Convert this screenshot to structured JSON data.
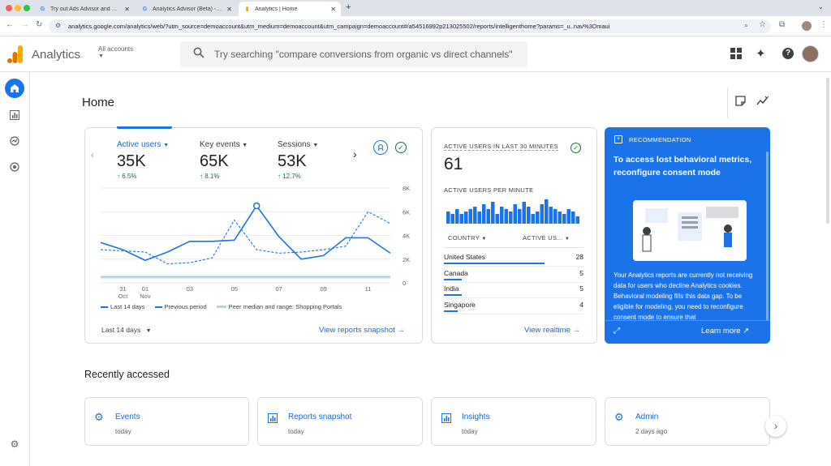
{
  "browser": {
    "tabs": [
      {
        "title": "Try out Ads Advisor and Analy"
      },
      {
        "title": "Analytics Advisor (Beta) - An"
      },
      {
        "title": "Analytics | Home"
      }
    ],
    "new_tab": "+",
    "url": "analytics.google.com/analytics/web/?utm_source=demoaccount&utm_medium=demoaccount&utm_campaign=demoaccount#/a54516992p213025502/reports/intelligenthome?params=_u..nav%3Dmaui"
  },
  "header": {
    "app_name": "Analytics",
    "account": "All accounts",
    "search_placeholder": "Try searching \"compare conversions from organic vs direct channels\""
  },
  "page": {
    "title": "Home"
  },
  "overview": {
    "metrics": [
      {
        "label": "Active users",
        "value": "35K",
        "change": "6.5%"
      },
      {
        "label": "Key events",
        "value": "65K",
        "change": "8.1%"
      },
      {
        "label": "Sessions",
        "value": "53K",
        "change": "12.7%"
      }
    ],
    "y_ticks": [
      "8K",
      "6K",
      "4K",
      "2K",
      "0"
    ],
    "x_ticks": [
      {
        "d": "31",
        "m": "Oct"
      },
      {
        "d": "01",
        "m": "Nov"
      },
      {
        "d": "03",
        "m": ""
      },
      {
        "d": "05",
        "m": ""
      },
      {
        "d": "07",
        "m": ""
      },
      {
        "d": "09",
        "m": ""
      },
      {
        "d": "11",
        "m": ""
      }
    ],
    "legend": [
      "Last 14 days",
      "Previous period",
      "Peer median and range: Shopping Portals"
    ],
    "date_range": "Last 14 days",
    "link": "View reports snapshot"
  },
  "chart_data": {
    "type": "line",
    "x": [
      "Oct 30",
      "Oct 31",
      "Nov 01",
      "Nov 02",
      "Nov 03",
      "Nov 04",
      "Nov 05",
      "Nov 06",
      "Nov 07",
      "Nov 08",
      "Nov 09",
      "Nov 10",
      "Nov 11",
      "Nov 12"
    ],
    "series": [
      {
        "name": "Last 14 days",
        "values": [
          3400,
          2800,
          1900,
          2600,
          3500,
          3500,
          3600,
          6500,
          3900,
          2000,
          2300,
          3800,
          3800,
          2500
        ]
      },
      {
        "name": "Previous period",
        "values": [
          2800,
          2700,
          2600,
          1600,
          1700,
          2100,
          5300,
          2800,
          2500,
          2600,
          2800,
          3100,
          6000,
          5000
        ]
      },
      {
        "name": "Peer median and range: Shopping Portals",
        "values": [
          500,
          500,
          500,
          500,
          500,
          500,
          500,
          500,
          500,
          500,
          500,
          500,
          500,
          500
        ]
      }
    ],
    "ylim": [
      0,
      8000
    ],
    "highlight_index": 7
  },
  "realtime": {
    "title": "ACTIVE USERS IN LAST 30 MINUTES",
    "value": "61",
    "per_minute_label": "ACTIVE USERS PER MINUTE",
    "per_minute": [
      5,
      4,
      6,
      4,
      5,
      6,
      7,
      5,
      8,
      6,
      9,
      4,
      7,
      6,
      5,
      8,
      6,
      9,
      7,
      4,
      5,
      8,
      10,
      7,
      6,
      5,
      4,
      6,
      5,
      3
    ],
    "col_country": "COUNTRY",
    "col_users": "ACTIVE US...",
    "rows": [
      {
        "country": "United States",
        "users": "28",
        "share": 0.72
      },
      {
        "country": "Canada",
        "users": "5",
        "share": 0.13
      },
      {
        "country": "India",
        "users": "5",
        "share": 0.13
      },
      {
        "country": "Singapore",
        "users": "4",
        "share": 0.1
      }
    ],
    "link": "View realtime"
  },
  "recommendation": {
    "label": "RECOMMENDATION",
    "title": "To access lost behavioral metrics, reconfigure consent mode",
    "body": "Your Analytics reports are currently not receiving data for users who decline Analytics cookies. Behavioral modeling fills this data gap. To be eligible for modeling, you need to reconfigure consent mode to ensure that",
    "learn_more": "Learn more"
  },
  "recent": {
    "title": "Recently accessed",
    "items": [
      {
        "title": "Events",
        "sub": "today"
      },
      {
        "title": "Reports snapshot",
        "sub": "today"
      },
      {
        "title": "Insights",
        "sub": "today"
      },
      {
        "title": "Admin",
        "sub": "2 days ago"
      }
    ]
  },
  "colors": {
    "primary": "#1a73e8",
    "positive": "#137333"
  }
}
